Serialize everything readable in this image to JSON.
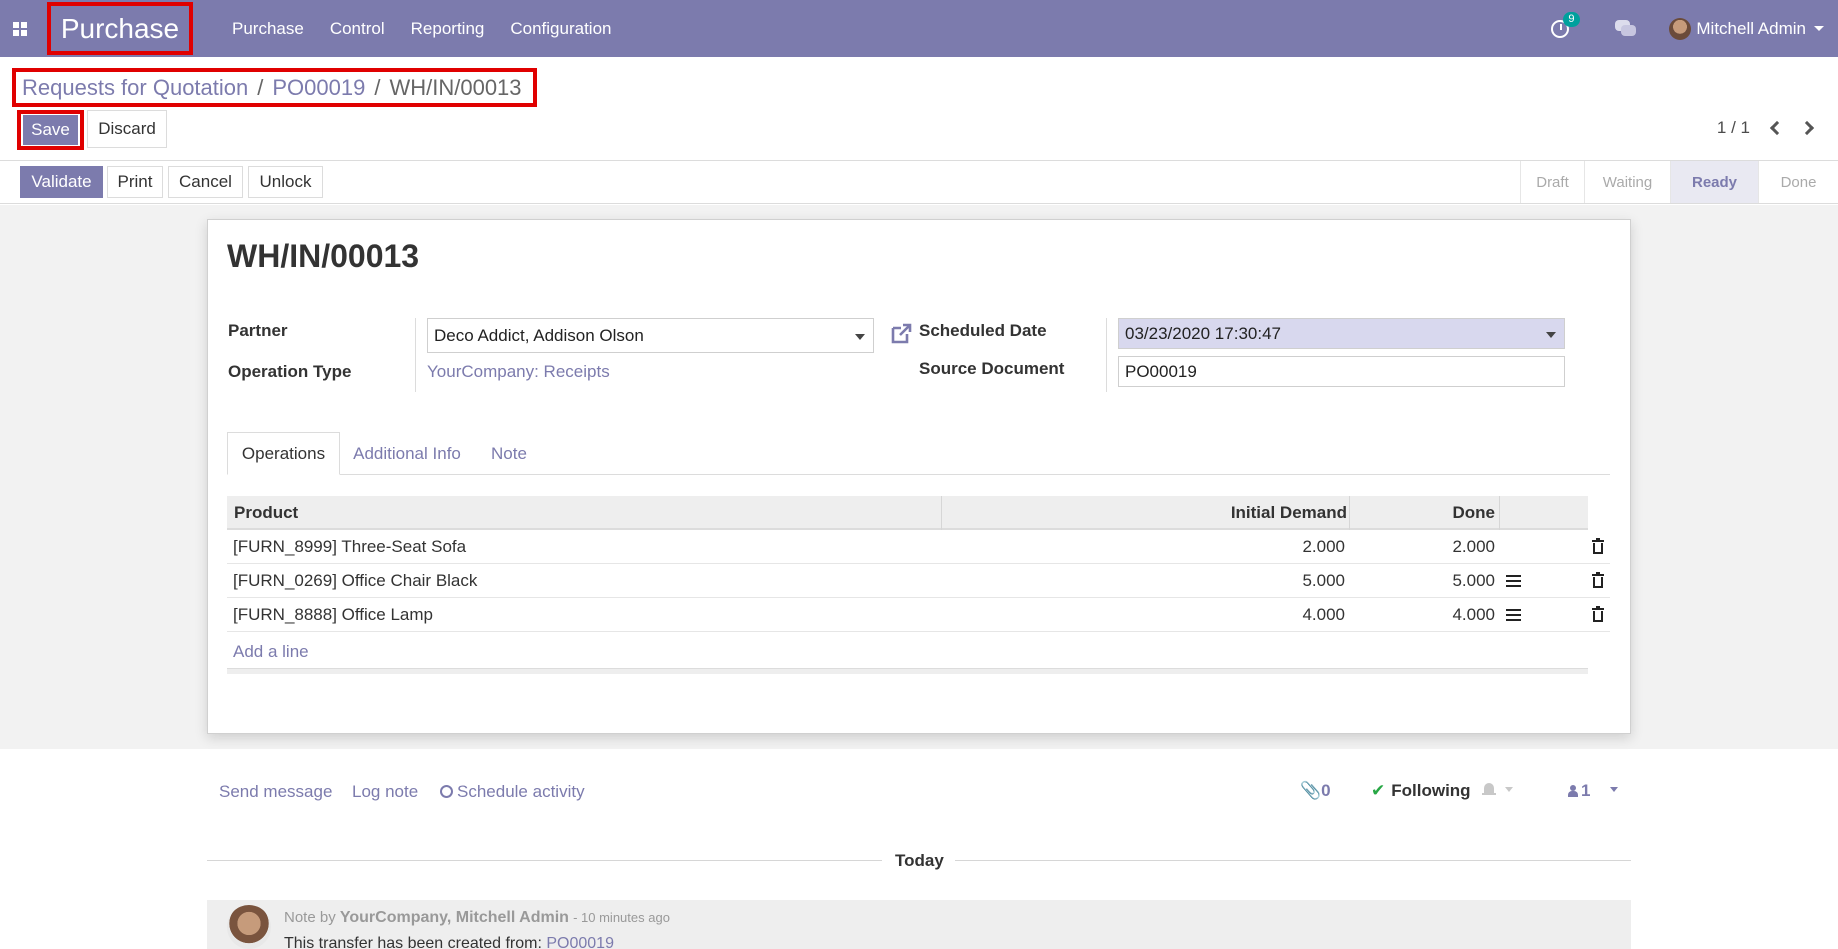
{
  "navbar": {
    "brand": "Purchase",
    "menu": [
      "Purchase",
      "Control",
      "Reporting",
      "Configuration"
    ],
    "activity_count": "9",
    "user_name": "Mitchell Admin"
  },
  "breadcrumb": {
    "items": [
      "Requests for Quotation",
      "PO00019"
    ],
    "separator": "/",
    "current": "WH/IN/00013"
  },
  "control": {
    "save_label": "Save",
    "discard_label": "Discard",
    "pager": "1 / 1"
  },
  "statusbar": {
    "buttons": [
      "Validate",
      "Print",
      "Cancel",
      "Unlock"
    ],
    "stages": [
      "Draft",
      "Waiting",
      "Ready",
      "Done"
    ],
    "active_stage": "Ready"
  },
  "form": {
    "title": "WH/IN/00013",
    "partner_label": "Partner",
    "partner_value": "Deco Addict, Addison Olson",
    "operation_type_label": "Operation Type",
    "operation_type_value": "YourCompany: Receipts",
    "scheduled_date_label": "Scheduled Date",
    "scheduled_date_value": "03/23/2020 17:30:47",
    "source_document_label": "Source Document",
    "source_document_value": "PO00019"
  },
  "tabs": [
    "Operations",
    "Additional Info",
    "Note"
  ],
  "operations": {
    "headers": [
      "Product",
      "Initial Demand",
      "Done"
    ],
    "rows": [
      {
        "product": "[FURN_8999] Three-Seat Sofa",
        "demand": "2.000",
        "done": "2.000"
      },
      {
        "product": "[FURN_0269] Office Chair Black",
        "demand": "5.000",
        "done": "5.000"
      },
      {
        "product": "[FURN_8888] Office Lamp",
        "demand": "4.000",
        "done": "4.000"
      }
    ],
    "add_line": "Add a line"
  },
  "chatter": {
    "send_message": "Send message",
    "log_note": "Log note",
    "schedule_activity": "Schedule activity",
    "attachments": "0",
    "following": "Following",
    "followers": "1",
    "today": "Today",
    "message": {
      "prefix": "Note by",
      "author": "YourCompany, Mitchell Admin",
      "ago": "- 10 minutes ago",
      "body": "This transfer has been created from:",
      "link": "PO00019"
    }
  },
  "colors": {
    "brand": "#7c7bad",
    "highlight_box": "#e00000",
    "badge": "#00a09d",
    "following_check": "#28a745"
  }
}
